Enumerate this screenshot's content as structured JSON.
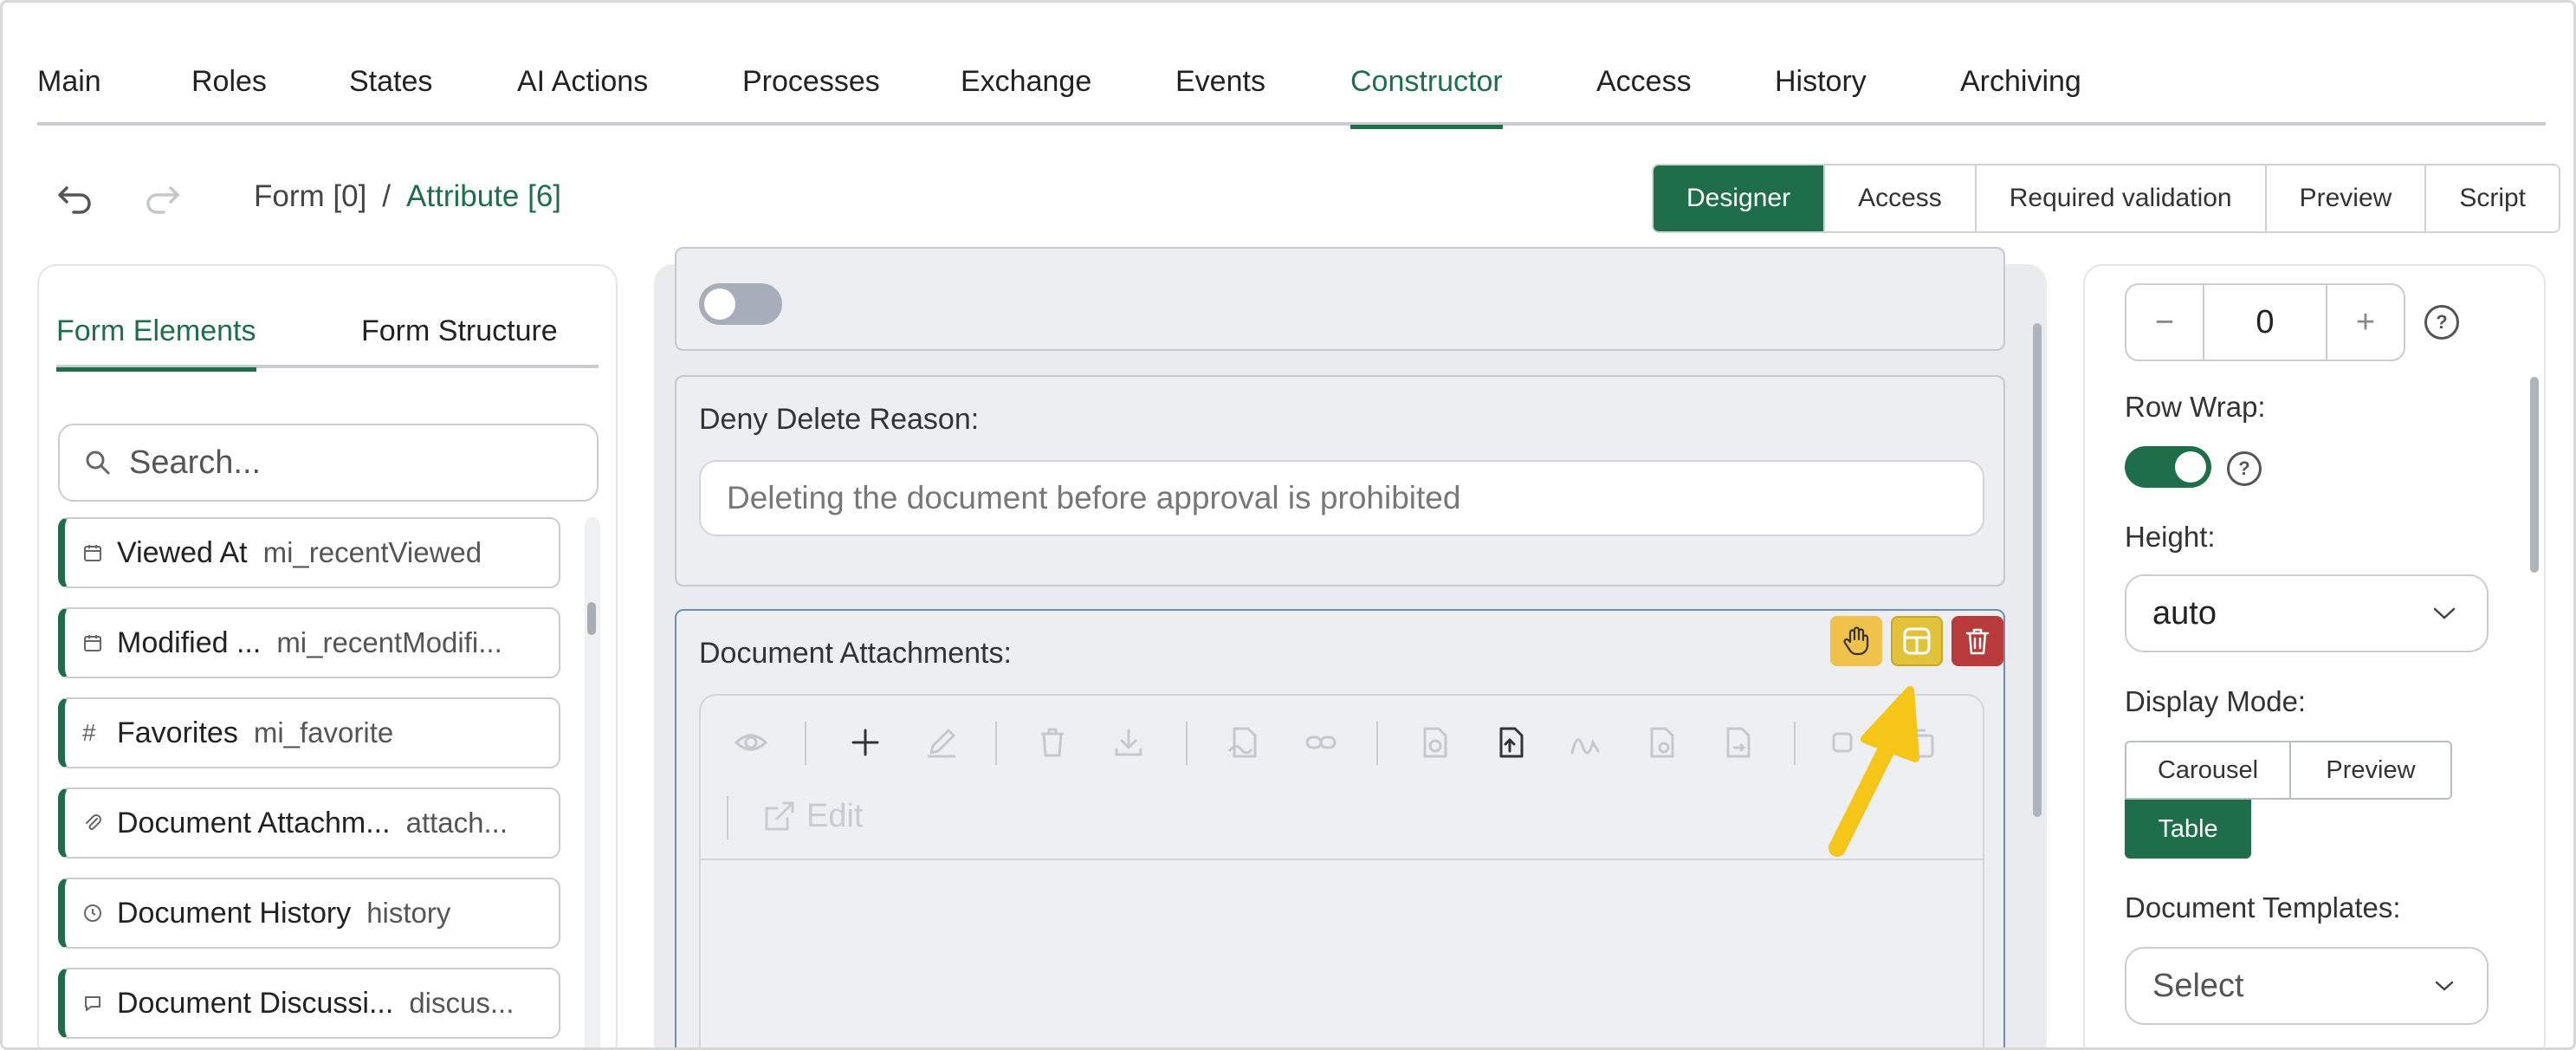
{
  "top_tabs": [
    {
      "label": "Main"
    },
    {
      "label": "Roles"
    },
    {
      "label": "States"
    },
    {
      "label": "AI Actions"
    },
    {
      "label": "Processes"
    },
    {
      "label": "Exchange"
    },
    {
      "label": "Events"
    },
    {
      "label": "Constructor",
      "active": true
    },
    {
      "label": "Access"
    },
    {
      "label": "History"
    },
    {
      "label": "Archiving"
    }
  ],
  "breadcrumb": {
    "root": "Form [0]",
    "separator": "/",
    "current": "Attribute [6]"
  },
  "mode_switch": [
    {
      "label": "Designer",
      "active": true
    },
    {
      "label": "Access"
    },
    {
      "label": "Required validation"
    },
    {
      "label": "Preview"
    },
    {
      "label": "Script"
    }
  ],
  "left_panel": {
    "tabs": [
      {
        "label": "Form Elements",
        "active": true
      },
      {
        "label": "Form Structure"
      }
    ],
    "search_placeholder": "Search...",
    "items": [
      {
        "icon": "calendar-icon",
        "label": "Viewed At",
        "code": "mi_recentViewed"
      },
      {
        "icon": "calendar-icon",
        "label": "Modified ...",
        "code": "mi_recentModifi..."
      },
      {
        "icon": "hash-icon",
        "label": "Favorites",
        "code": "mi_favorite"
      },
      {
        "icon": "paperclip-icon",
        "label": "Document Attachm...",
        "code": "attach..."
      },
      {
        "icon": "clock-icon",
        "label": "Document History",
        "code": "history"
      },
      {
        "icon": "chat-icon",
        "label": "Document Discussi...",
        "code": "discus..."
      }
    ]
  },
  "canvas": {
    "deny_label": "Deny Delete Reason:",
    "deny_value": "Deleting the document before approval is prohibited",
    "attach_label": "Document Attachments:",
    "edit_label": "Edit"
  },
  "right_panel": {
    "stepper_value": "0",
    "row_wrap_label": "Row Wrap:",
    "height_label": "Height:",
    "height_value": "auto",
    "display_mode_label": "Display Mode:",
    "display_modes": [
      {
        "label": "Carousel"
      },
      {
        "label": "Preview"
      },
      {
        "label": "Table",
        "active": true
      }
    ],
    "templates_label": "Document Templates:",
    "templates_placeholder": "Select"
  },
  "colors": {
    "accent": "#1f6e4a",
    "arrow": "#f5c518",
    "delete": "#b83a3a"
  }
}
